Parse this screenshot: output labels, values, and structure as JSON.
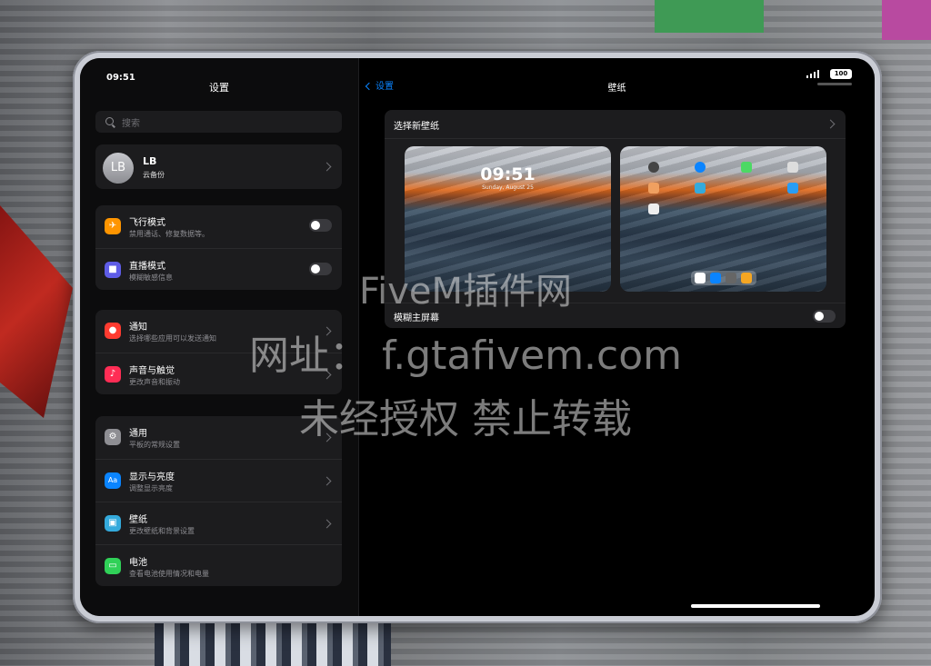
{
  "status_bar": {
    "time": "09:51",
    "battery": "100"
  },
  "sidebar": {
    "title": "设置",
    "search_placeholder": "搜索",
    "profile": {
      "initials": "LB",
      "name": "LB",
      "subtitle": "云备份"
    },
    "groups": [
      {
        "items": [
          {
            "label": "飞行模式",
            "subtitle": "禁用通话、修复数据等。",
            "icon": "airplane-icon",
            "color": "#ff9500",
            "control": "toggle",
            "on": false
          },
          {
            "label": "直播模式",
            "subtitle": "模糊敏感信息",
            "icon": "video-icon",
            "color": "#5e5ce6",
            "control": "toggle",
            "on": false
          }
        ]
      },
      {
        "items": [
          {
            "label": "通知",
            "subtitle": "选择哪些应用可以发送通知",
            "icon": "bell-icon",
            "color": "#ff3b30",
            "control": "chevron"
          },
          {
            "label": "声音与触觉",
            "subtitle": "更改声音和振动",
            "icon": "speaker-icon",
            "color": "#ff2d55",
            "control": "chevron"
          }
        ]
      },
      {
        "items": [
          {
            "label": "通用",
            "subtitle": "平板的常规设置",
            "icon": "gear-icon",
            "color": "#8e8e93",
            "control": "chevron"
          },
          {
            "label": "显示与亮度",
            "subtitle": "调整显示亮度",
            "icon": "text-size-icon",
            "color": "#0a84ff",
            "control": "chevron"
          },
          {
            "label": "壁纸",
            "subtitle": "更改壁纸和背景设置",
            "icon": "wallpaper-icon",
            "color": "#34aadc",
            "control": "chevron"
          },
          {
            "label": "电池",
            "subtitle": "查看电池使用情况和电量",
            "icon": "battery-icon",
            "color": "#30d158",
            "control": "none"
          }
        ]
      }
    ]
  },
  "main": {
    "back_label": "设置",
    "title": "壁纸",
    "choose_label": "选择新壁纸",
    "lock_preview": {
      "time": "09:51",
      "date": "Sunday, August 25"
    },
    "blur_label": "模糊主屏幕",
    "blur_on": false
  },
  "watermark": {
    "line1": "FiveM插件网",
    "line2": "网址： f.gtafivem.com",
    "line3": "未经授权 禁止转载"
  }
}
